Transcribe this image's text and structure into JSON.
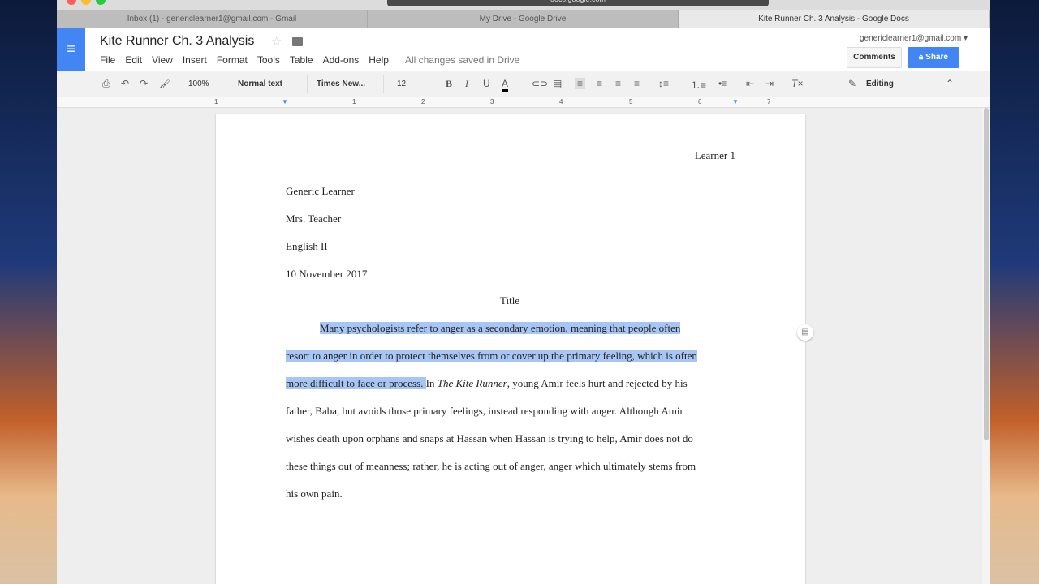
{
  "browser": {
    "url": "docs.google.com",
    "tabs": [
      "Inbox (1) - genericlearner1@gmail.com - Gmail",
      "My Drive - Google Drive",
      "Kite Runner Ch. 3 Analysis - Google Docs"
    ],
    "new_tab": "+"
  },
  "doc": {
    "title": "Kite Runner Ch. 3 Analysis",
    "menu": [
      "File",
      "Edit",
      "View",
      "Insert",
      "Format",
      "Tools",
      "Table",
      "Add-ons",
      "Help"
    ],
    "status": "All changes saved in Drive",
    "account": "genericlearner1@gmail.com ▾",
    "comments": "Comments",
    "share": "Share"
  },
  "toolbar": {
    "zoom": "100%",
    "style": "Normal text",
    "font": "Times New...",
    "size": "12",
    "mode": "Editing"
  },
  "ruler": [
    "1",
    "1",
    "2",
    "3",
    "4",
    "5",
    "6",
    "7"
  ],
  "page": {
    "header": "Learner 1",
    "heading": [
      "Generic Learner",
      "Mrs. Teacher",
      "English II",
      "10 November 2017"
    ],
    "title": "Title",
    "lines": [
      {
        "sel": "Many psychologists refer to anger as a secondary emotion, meaning that people often",
        "rest": ""
      },
      {
        "sel": "resort to anger in order to protect themselves from or cover up the primary feeling, which is often",
        "rest": ""
      },
      {
        "sel": "more difficult to face or process. ",
        "pre": "In ",
        "ital": "The Kite Runner",
        "rest": ", young Amir feels hurt and rejected by his"
      },
      {
        "sel": "",
        "rest": "father, Baba, but avoids those primary feelings, instead responding with anger. Although Amir"
      },
      {
        "sel": "",
        "rest": "wishes death upon orphans and snaps at Hassan when Hassan is trying to help, Amir does not do"
      },
      {
        "sel": "",
        "rest": "these things out of meanness; rather, he is acting out of anger, anger which ultimately stems from"
      },
      {
        "sel": "",
        "rest": "his own pain."
      }
    ]
  },
  "colors": {
    "accent": "#4285f4",
    "selection": "#a8c6f5"
  }
}
